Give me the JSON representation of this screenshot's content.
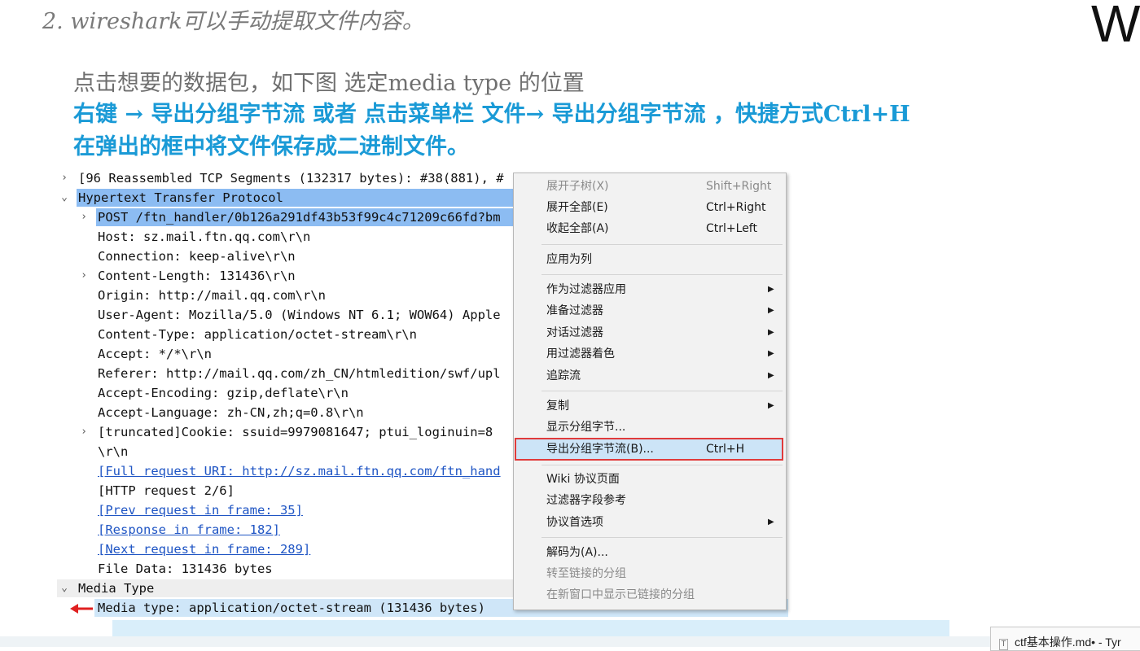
{
  "slide": {
    "title": "2. wireshark可以手动提取文件内容。",
    "logo": "W",
    "line1": "点击想要的数据包，如下图 选定media type 的位置",
    "line2": "右键 → 导出分组字节流   或者 点击菜单栏 文件→ 导出分组字节流 ，快捷方式Ctrl+H",
    "line3": "在弹出的框中将文件保存成二进制文件。"
  },
  "packet_details": [
    {
      "text": "[96 Reassembled TCP Segments (132317 bytes): #38(881), #",
      "arrow": "›",
      "indent": 0
    },
    {
      "text": "Hypertext Transfer Protocol",
      "arrow": "⌄",
      "indent": 0
    },
    {
      "text": "POST /ftn_handler/0b126a291df43b53f99c4c71209c66fd?bm",
      "arrow": "›",
      "indent": 1
    },
    {
      "text": "Host: sz.mail.ftn.qq.com\\r\\n",
      "arrow": "",
      "indent": 1
    },
    {
      "text": "Connection: keep-alive\\r\\n",
      "arrow": "",
      "indent": 1
    },
    {
      "text": "Content-Length: 131436\\r\\n",
      "arrow": "›",
      "indent": 1
    },
    {
      "text": "Origin: http://mail.qq.com\\r\\n",
      "arrow": "",
      "indent": 1
    },
    {
      "text": "User-Agent: Mozilla/5.0 (Windows NT 6.1; WOW64) Apple",
      "arrow": "",
      "indent": 1
    },
    {
      "text": "Content-Type: application/octet-stream\\r\\n",
      "arrow": "",
      "indent": 1
    },
    {
      "text": "Accept: */*\\r\\n",
      "arrow": "",
      "indent": 1
    },
    {
      "text": "Referer: http://mail.qq.com/zh_CN/htmledition/swf/upl",
      "arrow": "",
      "indent": 1
    },
    {
      "text": "Accept-Encoding: gzip,deflate\\r\\n",
      "arrow": "",
      "indent": 1
    },
    {
      "text": "Accept-Language: zh-CN,zh;q=0.8\\r\\n",
      "arrow": "",
      "indent": 1
    },
    {
      "text": " [truncated]Cookie: ssuid=9979081647; ptui_loginuin=8",
      "arrow": "›",
      "indent": 1
    },
    {
      "text": "\\r\\n",
      "arrow": "",
      "indent": 1
    },
    {
      "text": "[Full request URI: http://sz.mail.ftn.qq.com/ftn_hand",
      "arrow": "",
      "indent": 1
    },
    {
      "text": "[HTTP request 2/6]",
      "arrow": "",
      "indent": 1
    },
    {
      "text": "[Prev request in frame: 35]",
      "arrow": "",
      "indent": 1
    },
    {
      "text": "[Response in frame: 182]",
      "arrow": "",
      "indent": 1
    },
    {
      "text": "[Next request in frame: 289]",
      "arrow": "",
      "indent": 1
    },
    {
      "text": "File Data: 131436 bytes",
      "arrow": "",
      "indent": 1
    },
    {
      "text": "Media Type",
      "arrow": "⌄",
      "indent": 0
    },
    {
      "text": "Media type: application/octet-stream (131436 bytes)",
      "arrow": "",
      "indent": 1
    }
  ],
  "context_menu": [
    {
      "label": "展开子树(X)",
      "shortcut": "Shift+Right",
      "submenu": false,
      "disabled": true
    },
    {
      "label": "展开全部(E)",
      "shortcut": "Ctrl+Right",
      "submenu": false,
      "disabled": false
    },
    {
      "label": "收起全部(A)",
      "shortcut": "Ctrl+Left",
      "submenu": false,
      "disabled": false
    },
    {
      "label": "应用为列",
      "shortcut": "",
      "submenu": false,
      "disabled": false
    },
    {
      "label": "作为过滤器应用",
      "shortcut": "",
      "submenu": true,
      "disabled": false
    },
    {
      "label": "准备过滤器",
      "shortcut": "",
      "submenu": true,
      "disabled": false
    },
    {
      "label": "对话过滤器",
      "shortcut": "",
      "submenu": true,
      "disabled": false
    },
    {
      "label": "用过滤器着色",
      "shortcut": "",
      "submenu": true,
      "disabled": false
    },
    {
      "label": "追踪流",
      "shortcut": "",
      "submenu": true,
      "disabled": false
    },
    {
      "label": "复制",
      "shortcut": "",
      "submenu": true,
      "disabled": false
    },
    {
      "label": "显示分组字节...",
      "shortcut": "",
      "submenu": false,
      "disabled": false
    },
    {
      "label": "导出分组字节流(B)...",
      "shortcut": "Ctrl+H",
      "submenu": false,
      "disabled": false,
      "highlighted": true
    },
    {
      "label": "Wiki 协议页面",
      "shortcut": "",
      "submenu": false,
      "disabled": false
    },
    {
      "label": "过滤器字段参考",
      "shortcut": "",
      "submenu": false,
      "disabled": false
    },
    {
      "label": "协议首选项",
      "shortcut": "",
      "submenu": true,
      "disabled": false
    },
    {
      "label": "解码为(A)...",
      "shortcut": "",
      "submenu": false,
      "disabled": false
    },
    {
      "label": "转至链接的分组",
      "shortcut": "",
      "submenu": false,
      "disabled": true
    },
    {
      "label": "在新窗口中显示已链接的分组",
      "shortcut": "",
      "submenu": false,
      "disabled": true
    }
  ],
  "submenu_glyph": "▶",
  "taskbar_tab": {
    "label": "ctf基本操作.md• - Tyr",
    "icon": "T"
  },
  "colors": {
    "accent_blue": "#1a9ad6",
    "selection": "#8cbcf2",
    "highlight_border": "#e03b3b",
    "link": "#1f55c4"
  }
}
